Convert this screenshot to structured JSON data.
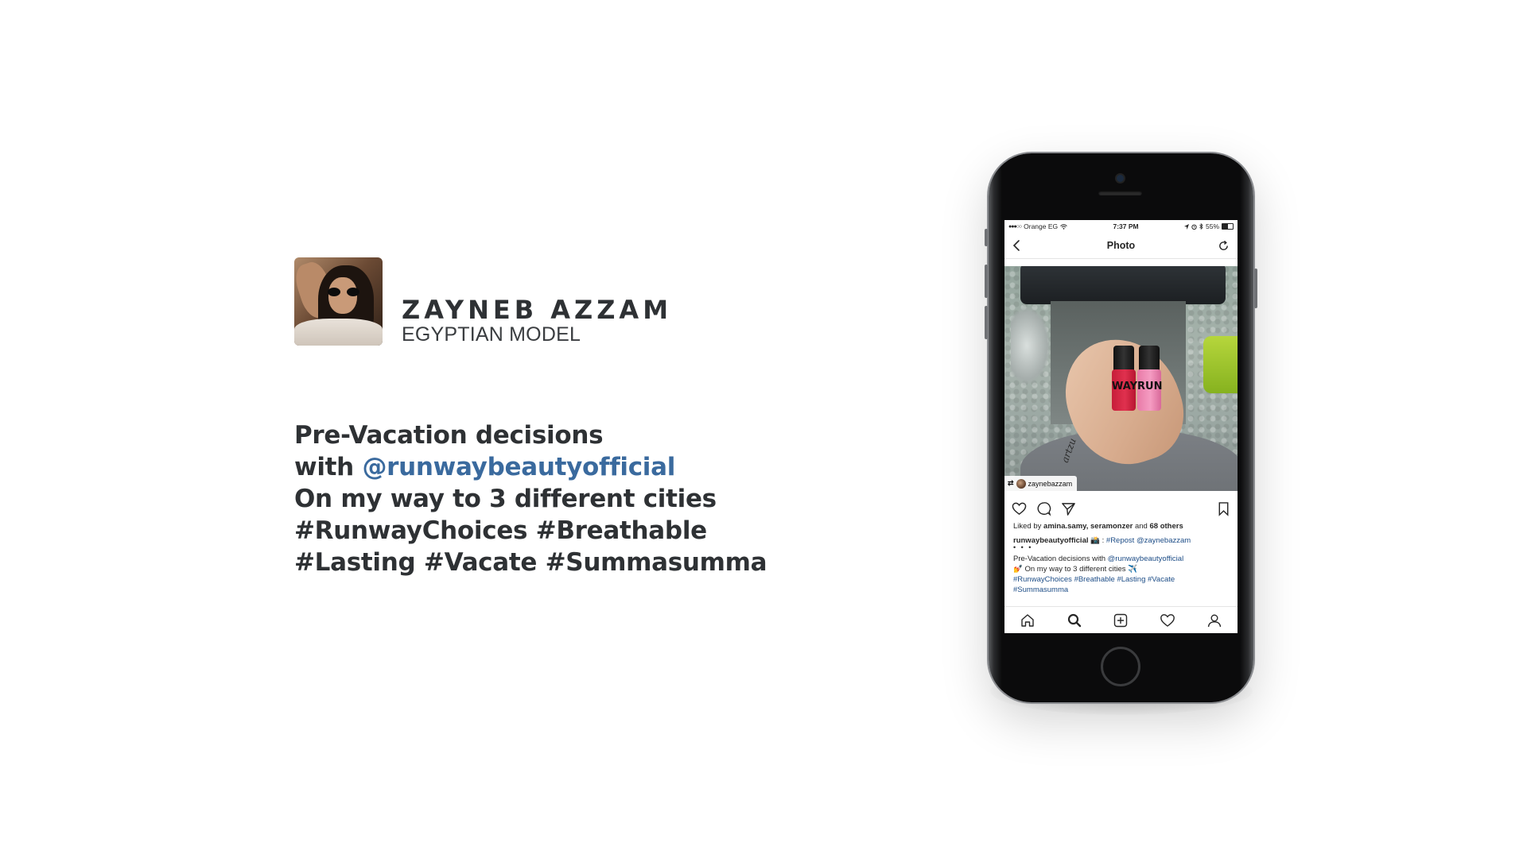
{
  "profile": {
    "name": "ZAYNEB AZZAM",
    "role": "EGYPTIAN MODEL"
  },
  "caption": {
    "line1": "Pre-Vacation decisions",
    "line2_prefix": "with ",
    "line2_mention": "@runwaybeautyofficial",
    "line3": "On my way to 3 different cities",
    "line4": "#RunwayChoices #Breathable",
    "line5": "#Lasting #Vacate #Summasumma"
  },
  "colors": {
    "text": "#2e3134",
    "mention": "#3a6a9e",
    "ig_link": "#1d4d87"
  },
  "phone": {
    "status": {
      "carrier": "Orange EG",
      "time": "7:37 PM",
      "battery": "55%"
    },
    "nav": {
      "title": "Photo",
      "back_icon": "chevron-left-icon",
      "refresh_icon": "refresh-icon"
    },
    "photo": {
      "repost_username": "zaynebazzam",
      "polish_labels": [
        "WAY",
        "RUN"
      ],
      "tattoo": "artzu"
    },
    "likes": {
      "prefix": "Liked by ",
      "names": "amina.samy, seramonzer",
      "and": " and ",
      "others": "68 others"
    },
    "post": {
      "username": "runwaybeautyofficial",
      "camera_emoji": "📸",
      "repost_label": " : ",
      "repost_tag": "#Repost",
      "repost_mention": "@zaynebazzam",
      "dots": "• • •",
      "body_prefix": "Pre-Vacation decisions with ",
      "body_mention": "@runwaybeautyofficial",
      "body_line2": "💅 On my way to 3 different cities ✈️",
      "hashtags_line1": "#RunwayChoices #Breathable #Lasting #Vacate",
      "hashtags_line2": "#Summasumma"
    },
    "tabs": [
      "home-icon",
      "search-icon",
      "add-post-icon",
      "heart-icon",
      "profile-icon"
    ]
  }
}
